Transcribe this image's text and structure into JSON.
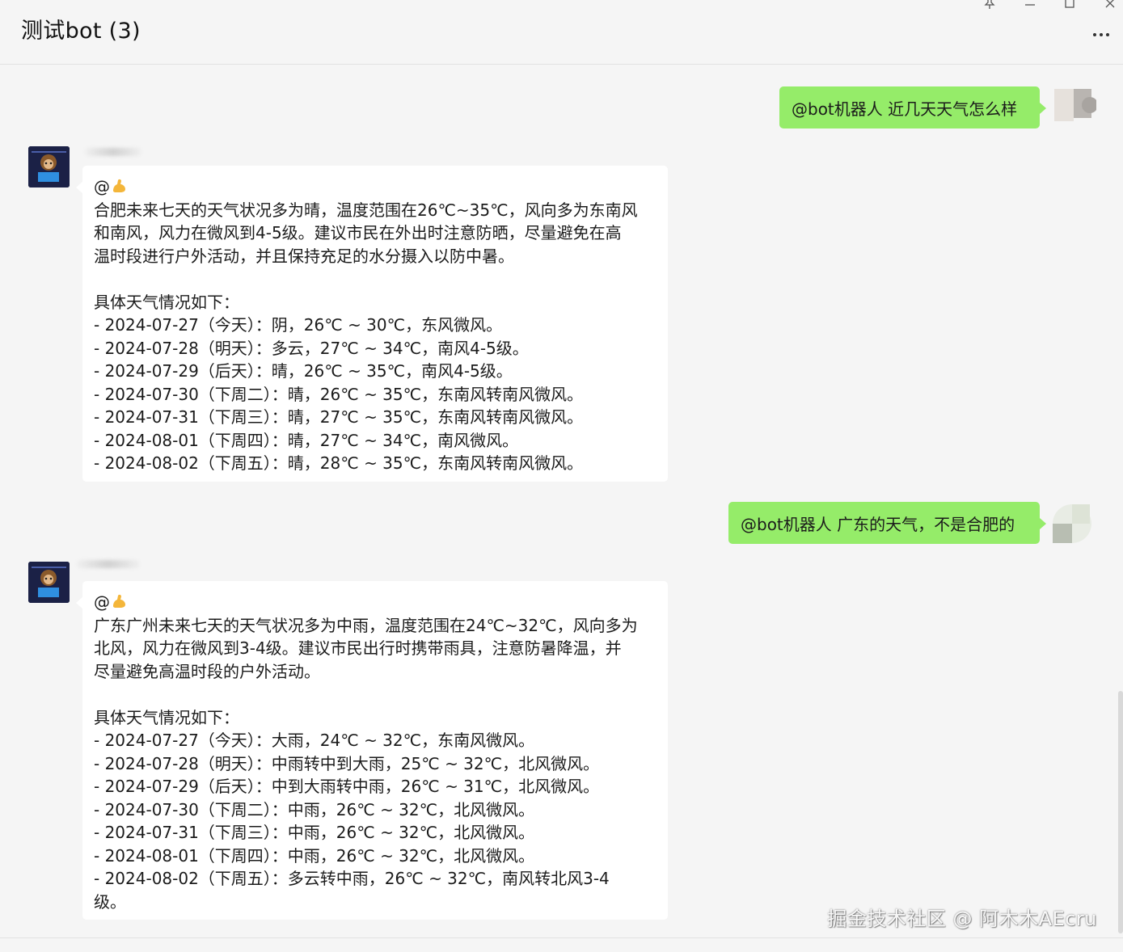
{
  "window": {
    "title": "测试bot (3)"
  },
  "messages": [
    {
      "sender": "self",
      "text": "@bot机器人 近几天天气怎么样"
    },
    {
      "sender": "bot",
      "mention": "@",
      "intro": [
        "合肥未来七天的天气状况多为晴，温度范围在26℃~35℃，风向多为东南风",
        "和南风，风力在微风到4-5级。建议市民在外出时注意防晒，尽量避免在高",
        "温时段进行户外活动，并且保持充足的水分摄入以防中暑。"
      ],
      "detail_header": "具体天气情况如下：",
      "details": [
        "- 2024-07-27（今天）：阴，26℃ ~ 30℃，东风微风。",
        "- 2024-07-28（明天）：多云，27℃ ~ 34℃，南风4-5级。",
        "- 2024-07-29（后天）：晴，26℃ ~ 35℃，南风4-5级。",
        "- 2024-07-30（下周二）：晴，26℃ ~ 35℃，东南风转南风微风。",
        "- 2024-07-31（下周三）：晴，27℃ ~ 35℃，东南风转南风微风。",
        "- 2024-08-01（下周四）：晴，27℃ ~ 34℃，南风微风。",
        "- 2024-08-02（下周五）：晴，28℃ ~ 35℃，东南风转南风微风。"
      ]
    },
    {
      "sender": "self",
      "text": "@bot机器人 广东的天气，不是合肥的"
    },
    {
      "sender": "bot",
      "mention": "@",
      "intro": [
        "广东广州未来七天的天气状况多为中雨，温度范围在24℃~32℃，风向多为",
        "北风，风力在微风到3-4级。建议市民出行时携带雨具，注意防暑降温，并",
        "尽量避免高温时段的户外活动。"
      ],
      "detail_header": "具体天气情况如下：",
      "details": [
        "- 2024-07-27（今天）：大雨，24℃ ~ 32℃，东南风微风。",
        "- 2024-07-28（明天）：中雨转中到大雨，25℃ ~ 32℃，北风微风。",
        "- 2024-07-29（后天）：中到大雨转中雨，26℃ ~ 31℃，北风微风。",
        "- 2024-07-30（下周二）：中雨，26℃ ~ 32℃，北风微风。",
        "- 2024-07-31（下周三）：中雨，26℃ ~ 32℃，北风微风。",
        "- 2024-08-01（下周四）：中雨，26℃ ~ 32℃，北风微风。",
        "- 2024-08-02（下周五）：多云转中雨，26℃ ~ 32℃，南风转北风3-4",
        "级。"
      ]
    }
  ],
  "watermark": "掘金技术社区 @ 阿木木AEcru",
  "icons": {
    "pin": "pin-icon",
    "minimize": "minimize-icon",
    "maximize": "maximize-icon",
    "close": "close-icon",
    "more": "more-icon",
    "flex": "flexed-biceps-emoji"
  },
  "colors": {
    "self_bubble": "#95ec69",
    "bot_bubble": "#ffffff",
    "background": "#f5f5f5"
  }
}
